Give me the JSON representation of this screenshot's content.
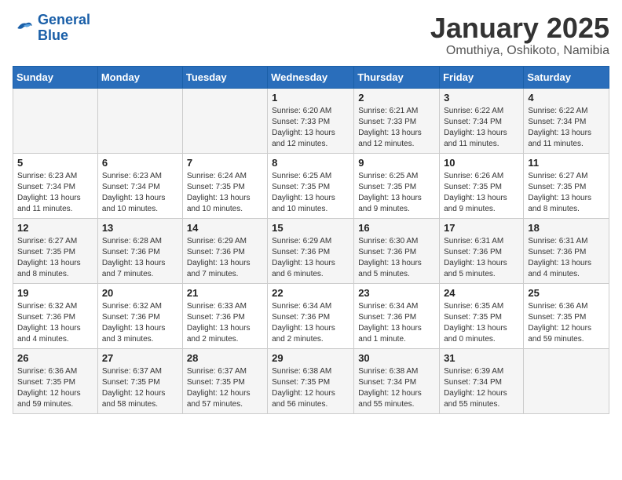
{
  "logo": {
    "line1": "General",
    "line2": "Blue"
  },
  "title": "January 2025",
  "location": "Omuthiya, Oshikoto, Namibia",
  "days_of_week": [
    "Sunday",
    "Monday",
    "Tuesday",
    "Wednesday",
    "Thursday",
    "Friday",
    "Saturday"
  ],
  "weeks": [
    [
      {
        "day": "",
        "info": ""
      },
      {
        "day": "",
        "info": ""
      },
      {
        "day": "",
        "info": ""
      },
      {
        "day": "1",
        "info": "Sunrise: 6:20 AM\nSunset: 7:33 PM\nDaylight: 13 hours and 12 minutes."
      },
      {
        "day": "2",
        "info": "Sunrise: 6:21 AM\nSunset: 7:33 PM\nDaylight: 13 hours and 12 minutes."
      },
      {
        "day": "3",
        "info": "Sunrise: 6:22 AM\nSunset: 7:34 PM\nDaylight: 13 hours and 11 minutes."
      },
      {
        "day": "4",
        "info": "Sunrise: 6:22 AM\nSunset: 7:34 PM\nDaylight: 13 hours and 11 minutes."
      }
    ],
    [
      {
        "day": "5",
        "info": "Sunrise: 6:23 AM\nSunset: 7:34 PM\nDaylight: 13 hours and 11 minutes."
      },
      {
        "day": "6",
        "info": "Sunrise: 6:23 AM\nSunset: 7:34 PM\nDaylight: 13 hours and 10 minutes."
      },
      {
        "day": "7",
        "info": "Sunrise: 6:24 AM\nSunset: 7:35 PM\nDaylight: 13 hours and 10 minutes."
      },
      {
        "day": "8",
        "info": "Sunrise: 6:25 AM\nSunset: 7:35 PM\nDaylight: 13 hours and 10 minutes."
      },
      {
        "day": "9",
        "info": "Sunrise: 6:25 AM\nSunset: 7:35 PM\nDaylight: 13 hours and 9 minutes."
      },
      {
        "day": "10",
        "info": "Sunrise: 6:26 AM\nSunset: 7:35 PM\nDaylight: 13 hours and 9 minutes."
      },
      {
        "day": "11",
        "info": "Sunrise: 6:27 AM\nSunset: 7:35 PM\nDaylight: 13 hours and 8 minutes."
      }
    ],
    [
      {
        "day": "12",
        "info": "Sunrise: 6:27 AM\nSunset: 7:35 PM\nDaylight: 13 hours and 8 minutes."
      },
      {
        "day": "13",
        "info": "Sunrise: 6:28 AM\nSunset: 7:36 PM\nDaylight: 13 hours and 7 minutes."
      },
      {
        "day": "14",
        "info": "Sunrise: 6:29 AM\nSunset: 7:36 PM\nDaylight: 13 hours and 7 minutes."
      },
      {
        "day": "15",
        "info": "Sunrise: 6:29 AM\nSunset: 7:36 PM\nDaylight: 13 hours and 6 minutes."
      },
      {
        "day": "16",
        "info": "Sunrise: 6:30 AM\nSunset: 7:36 PM\nDaylight: 13 hours and 5 minutes."
      },
      {
        "day": "17",
        "info": "Sunrise: 6:31 AM\nSunset: 7:36 PM\nDaylight: 13 hours and 5 minutes."
      },
      {
        "day": "18",
        "info": "Sunrise: 6:31 AM\nSunset: 7:36 PM\nDaylight: 13 hours and 4 minutes."
      }
    ],
    [
      {
        "day": "19",
        "info": "Sunrise: 6:32 AM\nSunset: 7:36 PM\nDaylight: 13 hours and 4 minutes."
      },
      {
        "day": "20",
        "info": "Sunrise: 6:32 AM\nSunset: 7:36 PM\nDaylight: 13 hours and 3 minutes."
      },
      {
        "day": "21",
        "info": "Sunrise: 6:33 AM\nSunset: 7:36 PM\nDaylight: 13 hours and 2 minutes."
      },
      {
        "day": "22",
        "info": "Sunrise: 6:34 AM\nSunset: 7:36 PM\nDaylight: 13 hours and 2 minutes."
      },
      {
        "day": "23",
        "info": "Sunrise: 6:34 AM\nSunset: 7:36 PM\nDaylight: 13 hours and 1 minute."
      },
      {
        "day": "24",
        "info": "Sunrise: 6:35 AM\nSunset: 7:35 PM\nDaylight: 13 hours and 0 minutes."
      },
      {
        "day": "25",
        "info": "Sunrise: 6:36 AM\nSunset: 7:35 PM\nDaylight: 12 hours and 59 minutes."
      }
    ],
    [
      {
        "day": "26",
        "info": "Sunrise: 6:36 AM\nSunset: 7:35 PM\nDaylight: 12 hours and 59 minutes."
      },
      {
        "day": "27",
        "info": "Sunrise: 6:37 AM\nSunset: 7:35 PM\nDaylight: 12 hours and 58 minutes."
      },
      {
        "day": "28",
        "info": "Sunrise: 6:37 AM\nSunset: 7:35 PM\nDaylight: 12 hours and 57 minutes."
      },
      {
        "day": "29",
        "info": "Sunrise: 6:38 AM\nSunset: 7:35 PM\nDaylight: 12 hours and 56 minutes."
      },
      {
        "day": "30",
        "info": "Sunrise: 6:38 AM\nSunset: 7:34 PM\nDaylight: 12 hours and 55 minutes."
      },
      {
        "day": "31",
        "info": "Sunrise: 6:39 AM\nSunset: 7:34 PM\nDaylight: 12 hours and 55 minutes."
      },
      {
        "day": "",
        "info": ""
      }
    ]
  ]
}
